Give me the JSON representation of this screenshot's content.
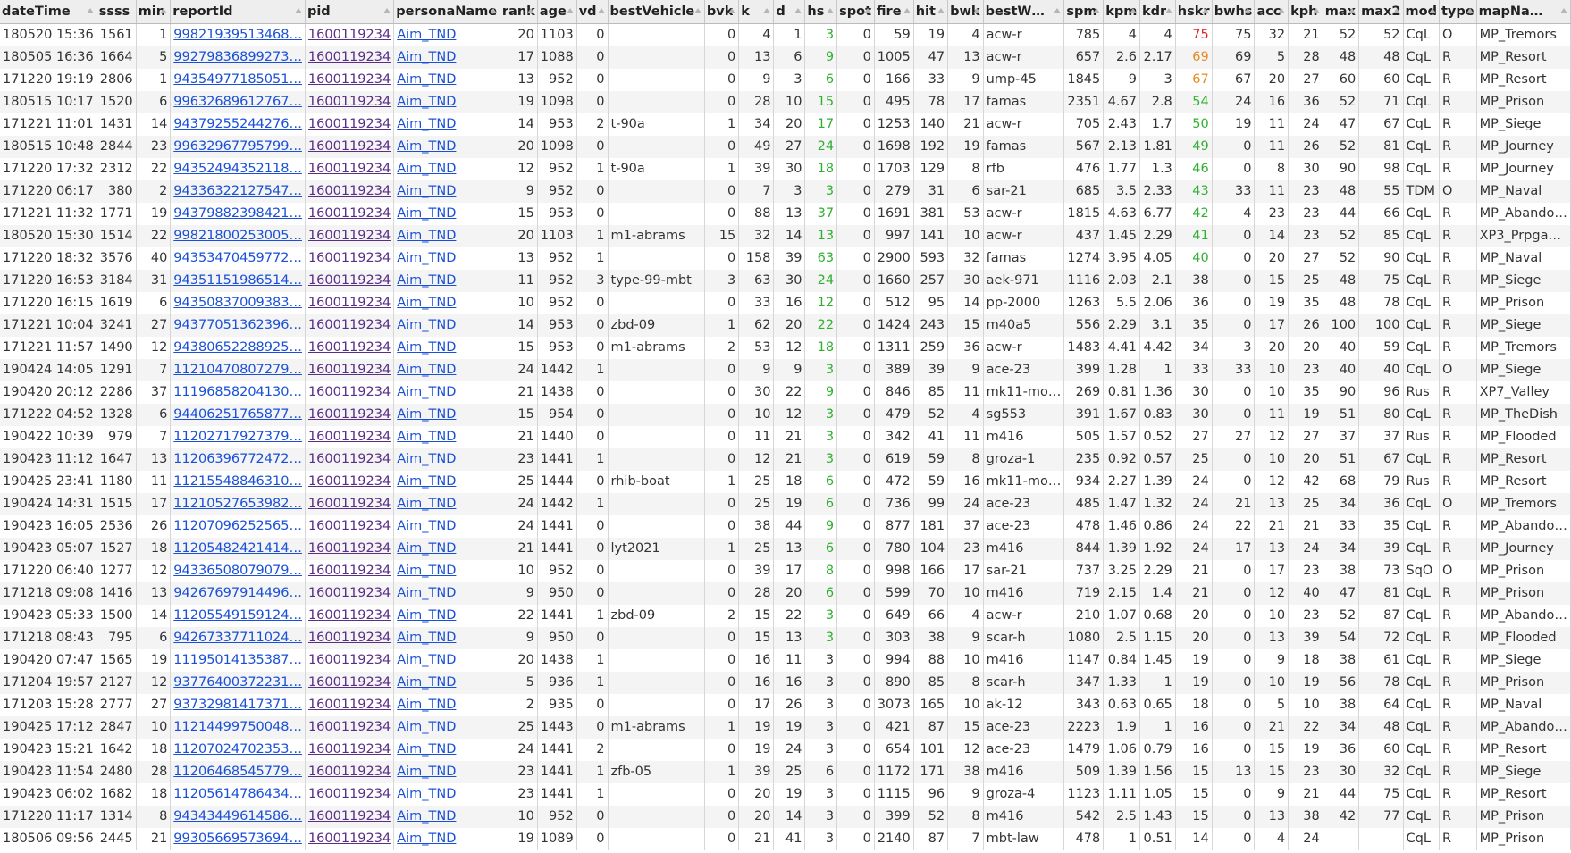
{
  "columns": [
    {
      "key": "dateTime",
      "label": "dateTime",
      "w": 93,
      "align": "left"
    },
    {
      "key": "ssss",
      "label": "ssss",
      "w": 37,
      "align": "right"
    },
    {
      "key": "min",
      "label": "min",
      "w": 35,
      "align": "right"
    },
    {
      "key": "reportId",
      "label": "reportId",
      "w": 131,
      "align": "link"
    },
    {
      "key": "pid",
      "label": "pid",
      "w": 89,
      "align": "pid"
    },
    {
      "key": "personaName",
      "label": "personaName",
      "w": 114,
      "align": "link"
    },
    {
      "key": "rank",
      "label": "rank",
      "w": 35,
      "align": "right"
    },
    {
      "key": "age",
      "label": "age",
      "w": 36,
      "align": "right"
    },
    {
      "key": "vd",
      "label": "vd",
      "w": 34,
      "align": "right"
    },
    {
      "key": "bestVehicle",
      "label": "bestVehicle",
      "w": 107,
      "align": "left"
    },
    {
      "key": "bvk",
      "label": "bvk",
      "w": 35,
      "align": "right"
    },
    {
      "key": "k",
      "label": "k",
      "w": 36,
      "align": "right"
    },
    {
      "key": "d",
      "label": "d",
      "w": 34,
      "align": "right"
    },
    {
      "key": "hs",
      "label": "hs",
      "w": 35,
      "align": "right"
    },
    {
      "key": "spot",
      "label": "spot",
      "w": 37,
      "align": "right"
    },
    {
      "key": "fire",
      "label": "fire",
      "w": 35,
      "align": "right"
    },
    {
      "key": "hit",
      "label": "hit",
      "w": 35,
      "align": "right"
    },
    {
      "key": "bwk",
      "label": "bwk",
      "w": 35,
      "align": "right"
    },
    {
      "key": "bestWeapon",
      "label": "bestW…",
      "w": 80,
      "align": "left"
    },
    {
      "key": "spm",
      "label": "spm",
      "w": 37,
      "align": "right"
    },
    {
      "key": "kpm",
      "label": "kpm",
      "w": 36,
      "align": "right"
    },
    {
      "key": "kdr",
      "label": "kdr",
      "w": 35,
      "align": "right"
    },
    {
      "key": "hskr",
      "label": "hskr",
      "w": 36,
      "align": "right"
    },
    {
      "key": "bwhs",
      "label": "bwhs",
      "w": 35,
      "align": "right"
    },
    {
      "key": "acc",
      "label": "acc",
      "w": 35,
      "align": "right"
    },
    {
      "key": "kph",
      "label": "kph",
      "w": 35,
      "align": "right"
    },
    {
      "key": "max",
      "label": "max",
      "w": 36,
      "align": "right"
    },
    {
      "key": "max2",
      "label": "max2",
      "w": 35,
      "align": "right"
    },
    {
      "key": "mod",
      "label": "mod",
      "w": 35,
      "align": "left"
    },
    {
      "key": "type",
      "label": "type",
      "w": 36,
      "align": "left"
    },
    {
      "key": "mapName",
      "label": "mapNa…",
      "w": 91,
      "align": "left"
    }
  ],
  "colors": {
    "hskr_red": "#e02020",
    "hskr_orange": "#e88a1c",
    "hskr_green": "#30b030",
    "hs_green": "#30b030",
    "link": "#1a50d8",
    "pid_visited": "#5a2e86"
  },
  "rows": [
    [
      "180520 15:36",
      "1561",
      "1",
      "99821939513468…",
      "1600119234",
      "Aim_TND",
      "20",
      "1103",
      "0",
      "",
      "0",
      "4",
      "1",
      "3",
      "0",
      "59",
      "19",
      "4",
      "acw-r",
      "785",
      "4",
      "4",
      "75",
      "75",
      "32",
      "21",
      "52",
      "52",
      "CqL",
      "O",
      "MP_Tremors"
    ],
    [
      "180505 16:36",
      "1664",
      "5",
      "99279836899273…",
      "1600119234",
      "Aim_TND",
      "17",
      "1088",
      "0",
      "",
      "0",
      "13",
      "6",
      "9",
      "0",
      "1005",
      "47",
      "13",
      "acw-r",
      "657",
      "2.6",
      "2.17",
      "69",
      "69",
      "5",
      "28",
      "48",
      "48",
      "CqL",
      "R",
      "MP_Resort"
    ],
    [
      "171220 19:19",
      "2806",
      "1",
      "94354977185051…",
      "1600119234",
      "Aim_TND",
      "13",
      "952",
      "0",
      "",
      "0",
      "9",
      "3",
      "6",
      "0",
      "166",
      "33",
      "9",
      "ump-45",
      "1845",
      "9",
      "3",
      "67",
      "67",
      "20",
      "27",
      "60",
      "60",
      "CqL",
      "R",
      "MP_Resort"
    ],
    [
      "180515 10:17",
      "1520",
      "6",
      "99632689612767…",
      "1600119234",
      "Aim_TND",
      "19",
      "1098",
      "0",
      "",
      "0",
      "28",
      "10",
      "15",
      "0",
      "495",
      "78",
      "17",
      "famas",
      "2351",
      "4.67",
      "2.8",
      "54",
      "24",
      "16",
      "36",
      "52",
      "71",
      "CqL",
      "R",
      "MP_Prison"
    ],
    [
      "171221 11:01",
      "1431",
      "14",
      "94379255244276…",
      "1600119234",
      "Aim_TND",
      "14",
      "953",
      "2",
      "t-90a",
      "1",
      "34",
      "20",
      "17",
      "0",
      "1253",
      "140",
      "21",
      "acw-r",
      "705",
      "2.43",
      "1.7",
      "50",
      "19",
      "11",
      "24",
      "47",
      "67",
      "CqL",
      "R",
      "MP_Siege"
    ],
    [
      "180515 10:48",
      "2844",
      "23",
      "99632967795799…",
      "1600119234",
      "Aim_TND",
      "20",
      "1098",
      "0",
      "",
      "0",
      "49",
      "27",
      "24",
      "0",
      "1698",
      "192",
      "19",
      "famas",
      "567",
      "2.13",
      "1.81",
      "49",
      "0",
      "11",
      "26",
      "52",
      "81",
      "CqL",
      "R",
      "MP_Journey"
    ],
    [
      "171220 17:32",
      "2312",
      "22",
      "94352494352118…",
      "1600119234",
      "Aim_TND",
      "12",
      "952",
      "1",
      "t-90a",
      "1",
      "39",
      "30",
      "18",
      "0",
      "1703",
      "129",
      "8",
      "rfb",
      "476",
      "1.77",
      "1.3",
      "46",
      "0",
      "8",
      "30",
      "90",
      "98",
      "CqL",
      "R",
      "MP_Journey"
    ],
    [
      "171220 06:17",
      "380",
      "2",
      "94336322127547…",
      "1600119234",
      "Aim_TND",
      "9",
      "952",
      "0",
      "",
      "0",
      "7",
      "3",
      "3",
      "0",
      "279",
      "31",
      "6",
      "sar-21",
      "685",
      "3.5",
      "2.33",
      "43",
      "33",
      "11",
      "23",
      "48",
      "55",
      "TDM",
      "O",
      "MP_Naval"
    ],
    [
      "171221 11:32",
      "1771",
      "19",
      "94379882398421…",
      "1600119234",
      "Aim_TND",
      "15",
      "953",
      "0",
      "",
      "0",
      "88",
      "13",
      "37",
      "0",
      "1691",
      "381",
      "53",
      "acw-r",
      "1815",
      "4.63",
      "6.77",
      "42",
      "4",
      "23",
      "23",
      "44",
      "66",
      "CqL",
      "R",
      "MP_Abando…"
    ],
    [
      "180520 15:30",
      "1514",
      "22",
      "99821800253005…",
      "1600119234",
      "Aim_TND",
      "20",
      "1103",
      "1",
      "m1-abrams",
      "15",
      "32",
      "14",
      "13",
      "0",
      "997",
      "141",
      "10",
      "acw-r",
      "437",
      "1.45",
      "2.29",
      "41",
      "0",
      "14",
      "23",
      "52",
      "85",
      "CqL",
      "R",
      "XP3_Prpga…"
    ],
    [
      "171220 18:32",
      "3576",
      "40",
      "94353470459772…",
      "1600119234",
      "Aim_TND",
      "13",
      "952",
      "1",
      "",
      "0",
      "158",
      "39",
      "63",
      "0",
      "2900",
      "593",
      "32",
      "famas",
      "1274",
      "3.95",
      "4.05",
      "40",
      "0",
      "20",
      "27",
      "52",
      "90",
      "CqL",
      "R",
      "MP_Naval"
    ],
    [
      "171220 16:53",
      "3184",
      "31",
      "94351151986514…",
      "1600119234",
      "Aim_TND",
      "11",
      "952",
      "3",
      "type-99-mbt",
      "3",
      "63",
      "30",
      "24",
      "0",
      "1660",
      "257",
      "30",
      "aek-971",
      "1116",
      "2.03",
      "2.1",
      "38",
      "0",
      "15",
      "25",
      "48",
      "75",
      "CqL",
      "R",
      "MP_Siege"
    ],
    [
      "171220 16:15",
      "1619",
      "6",
      "94350837009383…",
      "1600119234",
      "Aim_TND",
      "10",
      "952",
      "0",
      "",
      "0",
      "33",
      "16",
      "12",
      "0",
      "512",
      "95",
      "14",
      "pp-2000",
      "1263",
      "5.5",
      "2.06",
      "36",
      "0",
      "19",
      "35",
      "48",
      "78",
      "CqL",
      "R",
      "MP_Prison"
    ],
    [
      "171221 10:04",
      "3241",
      "27",
      "94377051362396…",
      "1600119234",
      "Aim_TND",
      "14",
      "953",
      "0",
      "zbd-09",
      "1",
      "62",
      "20",
      "22",
      "0",
      "1424",
      "243",
      "15",
      "m40a5",
      "556",
      "2.29",
      "3.1",
      "35",
      "0",
      "17",
      "26",
      "100",
      "100",
      "CqL",
      "R",
      "MP_Siege"
    ],
    [
      "171221 11:57",
      "1490",
      "12",
      "94380652288925…",
      "1600119234",
      "Aim_TND",
      "15",
      "953",
      "0",
      "m1-abrams",
      "2",
      "53",
      "12",
      "18",
      "0",
      "1311",
      "259",
      "36",
      "acw-r",
      "1483",
      "4.41",
      "4.42",
      "34",
      "3",
      "20",
      "20",
      "40",
      "59",
      "CqL",
      "R",
      "MP_Tremors"
    ],
    [
      "190424 14:05",
      "1291",
      "7",
      "11210470807279…",
      "1600119234",
      "Aim_TND",
      "24",
      "1442",
      "1",
      "",
      "0",
      "9",
      "9",
      "3",
      "0",
      "389",
      "39",
      "9",
      "ace-23",
      "399",
      "1.28",
      "1",
      "33",
      "33",
      "10",
      "23",
      "40",
      "40",
      "CqL",
      "O",
      "MP_Siege"
    ],
    [
      "190420 20:12",
      "2286",
      "37",
      "11196858204130…",
      "1600119234",
      "Aim_TND",
      "21",
      "1438",
      "0",
      "",
      "0",
      "30",
      "22",
      "9",
      "0",
      "846",
      "85",
      "11",
      "mk11-mo…",
      "269",
      "0.81",
      "1.36",
      "30",
      "0",
      "10",
      "35",
      "90",
      "96",
      "Rus",
      "R",
      "XP7_Valley"
    ],
    [
      "171222 04:52",
      "1328",
      "6",
      "94406251765877…",
      "1600119234",
      "Aim_TND",
      "15",
      "954",
      "0",
      "",
      "0",
      "10",
      "12",
      "3",
      "0",
      "479",
      "52",
      "4",
      "sg553",
      "391",
      "1.67",
      "0.83",
      "30",
      "0",
      "11",
      "19",
      "51",
      "80",
      "CqL",
      "R",
      "MP_TheDish"
    ],
    [
      "190422 10:39",
      "979",
      "7",
      "11202717927379…",
      "1600119234",
      "Aim_TND",
      "21",
      "1440",
      "0",
      "",
      "0",
      "11",
      "21",
      "3",
      "0",
      "342",
      "41",
      "11",
      "m416",
      "505",
      "1.57",
      "0.52",
      "27",
      "27",
      "12",
      "27",
      "37",
      "37",
      "Rus",
      "R",
      "MP_Flooded"
    ],
    [
      "190423 11:12",
      "1647",
      "13",
      "11206396772472…",
      "1600119234",
      "Aim_TND",
      "23",
      "1441",
      "1",
      "",
      "0",
      "12",
      "21",
      "3",
      "0",
      "619",
      "59",
      "8",
      "groza-1",
      "235",
      "0.92",
      "0.57",
      "25",
      "0",
      "10",
      "20",
      "51",
      "67",
      "CqL",
      "R",
      "MP_Resort"
    ],
    [
      "190425 23:41",
      "1180",
      "11",
      "11215548846310…",
      "1600119234",
      "Aim_TND",
      "25",
      "1444",
      "0",
      "rhib-boat",
      "1",
      "25",
      "18",
      "6",
      "0",
      "472",
      "59",
      "16",
      "mk11-mo…",
      "934",
      "2.27",
      "1.39",
      "24",
      "0",
      "12",
      "42",
      "68",
      "79",
      "Rus",
      "R",
      "MP_Resort"
    ],
    [
      "190424 14:31",
      "1515",
      "17",
      "11210527653982…",
      "1600119234",
      "Aim_TND",
      "24",
      "1442",
      "1",
      "",
      "0",
      "25",
      "19",
      "6",
      "0",
      "736",
      "99",
      "24",
      "ace-23",
      "485",
      "1.47",
      "1.32",
      "24",
      "21",
      "13",
      "25",
      "34",
      "36",
      "CqL",
      "O",
      "MP_Tremors"
    ],
    [
      "190423 16:05",
      "2536",
      "26",
      "11207096252565…",
      "1600119234",
      "Aim_TND",
      "24",
      "1441",
      "0",
      "",
      "0",
      "38",
      "44",
      "9",
      "0",
      "877",
      "181",
      "37",
      "ace-23",
      "478",
      "1.46",
      "0.86",
      "24",
      "22",
      "21",
      "21",
      "33",
      "35",
      "CqL",
      "R",
      "MP_Abando…"
    ],
    [
      "190423 05:07",
      "1527",
      "18",
      "11205482421414…",
      "1600119234",
      "Aim_TND",
      "21",
      "1441",
      "0",
      "lyt2021",
      "1",
      "25",
      "13",
      "6",
      "0",
      "780",
      "104",
      "23",
      "m416",
      "844",
      "1.39",
      "1.92",
      "24",
      "17",
      "13",
      "24",
      "34",
      "39",
      "CqL",
      "R",
      "MP_Journey"
    ],
    [
      "171220 06:40",
      "1277",
      "12",
      "94336508079079…",
      "1600119234",
      "Aim_TND",
      "10",
      "952",
      "0",
      "",
      "0",
      "39",
      "17",
      "8",
      "0",
      "998",
      "166",
      "17",
      "sar-21",
      "737",
      "3.25",
      "2.29",
      "21",
      "0",
      "17",
      "23",
      "38",
      "73",
      "SqO",
      "O",
      "MP_Prison"
    ],
    [
      "171218 09:08",
      "1416",
      "13",
      "94267697914496…",
      "1600119234",
      "Aim_TND",
      "9",
      "950",
      "0",
      "",
      "0",
      "28",
      "20",
      "6",
      "0",
      "599",
      "70",
      "10",
      "m416",
      "719",
      "2.15",
      "1.4",
      "21",
      "0",
      "12",
      "40",
      "47",
      "81",
      "CqL",
      "R",
      "MP_Prison"
    ],
    [
      "190423 05:33",
      "1500",
      "14",
      "11205549159124…",
      "1600119234",
      "Aim_TND",
      "22",
      "1441",
      "1",
      "zbd-09",
      "2",
      "15",
      "22",
      "3",
      "0",
      "649",
      "66",
      "4",
      "acw-r",
      "210",
      "1.07",
      "0.68",
      "20",
      "0",
      "10",
      "23",
      "52",
      "87",
      "CqL",
      "R",
      "MP_Abando…"
    ],
    [
      "171218 08:43",
      "795",
      "6",
      "94267337711024…",
      "1600119234",
      "Aim_TND",
      "9",
      "950",
      "0",
      "",
      "0",
      "15",
      "13",
      "3",
      "0",
      "303",
      "38",
      "9",
      "scar-h",
      "1080",
      "2.5",
      "1.15",
      "20",
      "0",
      "13",
      "39",
      "54",
      "72",
      "CqL",
      "R",
      "MP_Flooded"
    ],
    [
      "190420 07:47",
      "1565",
      "19",
      "11195014135387…",
      "1600119234",
      "Aim_TND",
      "20",
      "1438",
      "1",
      "",
      "0",
      "16",
      "11",
      "3",
      "0",
      "994",
      "88",
      "10",
      "m416",
      "1147",
      "0.84",
      "1.45",
      "19",
      "0",
      "9",
      "18",
      "38",
      "61",
      "CqL",
      "R",
      "MP_Siege"
    ],
    [
      "171204 19:57",
      "2127",
      "12",
      "93776400372231…",
      "1600119234",
      "Aim_TND",
      "5",
      "936",
      "1",
      "",
      "0",
      "16",
      "16",
      "3",
      "0",
      "890",
      "85",
      "8",
      "scar-h",
      "347",
      "1.33",
      "1",
      "19",
      "0",
      "10",
      "19",
      "56",
      "78",
      "CqL",
      "R",
      "MP_Prison"
    ],
    [
      "171203 15:28",
      "2777",
      "27",
      "93732981417371…",
      "1600119234",
      "Aim_TND",
      "2",
      "935",
      "0",
      "",
      "0",
      "17",
      "26",
      "3",
      "0",
      "3073",
      "165",
      "10",
      "ak-12",
      "343",
      "0.63",
      "0.65",
      "18",
      "0",
      "5",
      "10",
      "38",
      "64",
      "CqL",
      "R",
      "MP_Naval"
    ],
    [
      "190425 17:12",
      "2847",
      "10",
      "11214499750048…",
      "1600119234",
      "Aim_TND",
      "25",
      "1443",
      "0",
      "m1-abrams",
      "1",
      "19",
      "19",
      "3",
      "0",
      "421",
      "87",
      "15",
      "ace-23",
      "2223",
      "1.9",
      "1",
      "16",
      "0",
      "21",
      "22",
      "34",
      "48",
      "CqL",
      "R",
      "MP_Abando…"
    ],
    [
      "190423 15:21",
      "1642",
      "18",
      "11207024702353…",
      "1600119234",
      "Aim_TND",
      "24",
      "1441",
      "2",
      "",
      "0",
      "19",
      "24",
      "3",
      "0",
      "654",
      "101",
      "12",
      "ace-23",
      "1479",
      "1.06",
      "0.79",
      "16",
      "0",
      "15",
      "19",
      "36",
      "60",
      "CqL",
      "R",
      "MP_Resort"
    ],
    [
      "190423 11:54",
      "2480",
      "28",
      "11206468545779…",
      "1600119234",
      "Aim_TND",
      "23",
      "1441",
      "1",
      "zfb-05",
      "1",
      "39",
      "25",
      "6",
      "0",
      "1172",
      "171",
      "38",
      "m416",
      "509",
      "1.39",
      "1.56",
      "15",
      "13",
      "15",
      "23",
      "30",
      "32",
      "CqL",
      "R",
      "MP_Siege"
    ],
    [
      "190423 06:02",
      "1682",
      "18",
      "11205614786434…",
      "1600119234",
      "Aim_TND",
      "23",
      "1441",
      "1",
      "",
      "0",
      "20",
      "19",
      "3",
      "0",
      "1115",
      "96",
      "9",
      "groza-4",
      "1123",
      "1.11",
      "1.05",
      "15",
      "0",
      "9",
      "21",
      "44",
      "75",
      "CqL",
      "R",
      "MP_Resort"
    ],
    [
      "171220 11:17",
      "1314",
      "8",
      "94343449614586…",
      "1600119234",
      "Aim_TND",
      "10",
      "952",
      "0",
      "",
      "0",
      "20",
      "14",
      "3",
      "0",
      "399",
      "52",
      "8",
      "m416",
      "542",
      "2.5",
      "1.43",
      "15",
      "0",
      "13",
      "38",
      "42",
      "77",
      "CqL",
      "R",
      "MP_Prison"
    ],
    [
      "180506 09:56",
      "2445",
      "21",
      "99305669573694…",
      "1600119234",
      "Aim_TND",
      "19",
      "1089",
      "0",
      "",
      "0",
      "21",
      "41",
      "3",
      "0",
      "2140",
      "87",
      "7",
      "mbt-law",
      "478",
      "1",
      "0.51",
      "14",
      "0",
      "4",
      "24",
      "",
      "",
      "CqL",
      "R",
      "MP_Prison"
    ]
  ]
}
